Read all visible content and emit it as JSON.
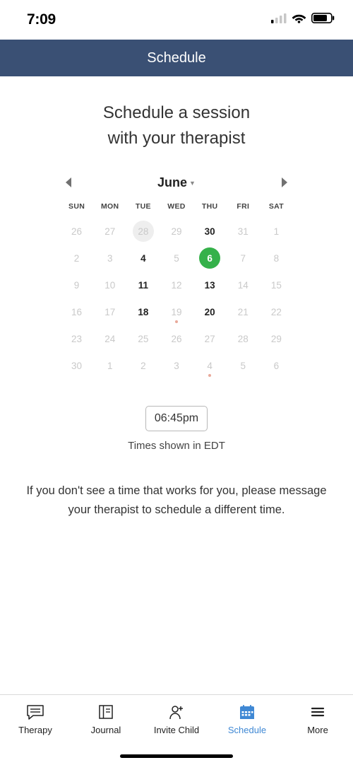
{
  "status": {
    "time": "7:09"
  },
  "header": {
    "title": "Schedule"
  },
  "title": {
    "line1": "Schedule a session",
    "line2": "with your therapist"
  },
  "calendar": {
    "month": "June",
    "dow": [
      "SUN",
      "MON",
      "TUE",
      "WED",
      "THU",
      "FRI",
      "SAT"
    ],
    "weeks": [
      [
        {
          "n": "26",
          "available": false
        },
        {
          "n": "27",
          "available": false
        },
        {
          "n": "28",
          "available": false,
          "today": true
        },
        {
          "n": "29",
          "available": false
        },
        {
          "n": "30",
          "available": true
        },
        {
          "n": "31",
          "available": false
        },
        {
          "n": "1",
          "available": false
        }
      ],
      [
        {
          "n": "2",
          "available": false
        },
        {
          "n": "3",
          "available": false
        },
        {
          "n": "4",
          "available": true
        },
        {
          "n": "5",
          "available": false
        },
        {
          "n": "6",
          "available": true,
          "selected": true
        },
        {
          "n": "7",
          "available": false
        },
        {
          "n": "8",
          "available": false
        }
      ],
      [
        {
          "n": "9",
          "available": false
        },
        {
          "n": "10",
          "available": false
        },
        {
          "n": "11",
          "available": true
        },
        {
          "n": "12",
          "available": false
        },
        {
          "n": "13",
          "available": true
        },
        {
          "n": "14",
          "available": false
        },
        {
          "n": "15",
          "available": false
        }
      ],
      [
        {
          "n": "16",
          "available": false
        },
        {
          "n": "17",
          "available": false
        },
        {
          "n": "18",
          "available": true
        },
        {
          "n": "19",
          "available": false,
          "dot": true
        },
        {
          "n": "20",
          "available": true
        },
        {
          "n": "21",
          "available": false
        },
        {
          "n": "22",
          "available": false
        }
      ],
      [
        {
          "n": "23",
          "available": false
        },
        {
          "n": "24",
          "available": false
        },
        {
          "n": "25",
          "available": false
        },
        {
          "n": "26",
          "available": false
        },
        {
          "n": "27",
          "available": false
        },
        {
          "n": "28",
          "available": false
        },
        {
          "n": "29",
          "available": false
        }
      ],
      [
        {
          "n": "30",
          "available": false
        },
        {
          "n": "1",
          "available": false
        },
        {
          "n": "2",
          "available": false
        },
        {
          "n": "3",
          "available": false
        },
        {
          "n": "4",
          "available": false,
          "dot": true
        },
        {
          "n": "5",
          "available": false
        },
        {
          "n": "6",
          "available": false
        }
      ]
    ]
  },
  "timeslot": {
    "label": "06:45pm",
    "tz_note": "Times shown in EDT"
  },
  "help_text": "If you don't see a time that works for you, please message your therapist to schedule a different time.",
  "tabs": {
    "therapy": "Therapy",
    "journal": "Journal",
    "invite": "Invite Child",
    "schedule": "Schedule",
    "more": "More"
  }
}
